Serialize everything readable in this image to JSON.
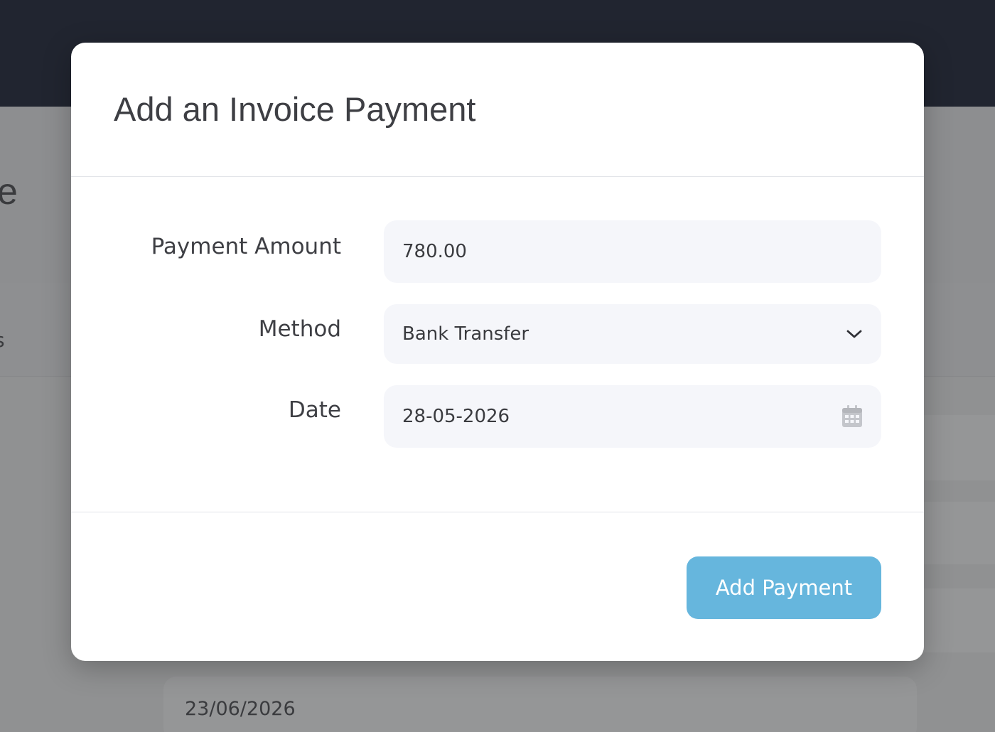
{
  "background": {
    "title_fragment": "e",
    "tab_fragment": "s",
    "date_value": "23/06/2026"
  },
  "modal": {
    "title": "Add an Invoice Payment",
    "fields": {
      "amount": {
        "label": "Payment Amount",
        "value": "780.00"
      },
      "method": {
        "label": "Method",
        "value": "Bank Transfer",
        "icon": "chevron-down-icon"
      },
      "date": {
        "label": "Date",
        "value": "28-05-2026",
        "icon": "calendar-icon"
      }
    },
    "submit_label": "Add Payment"
  },
  "colors": {
    "topbar": "#212530",
    "overlay": "#8f9092",
    "input_bg": "#f5f6fa",
    "primary_button": "#66b6dd",
    "text": "#3e3f44"
  }
}
